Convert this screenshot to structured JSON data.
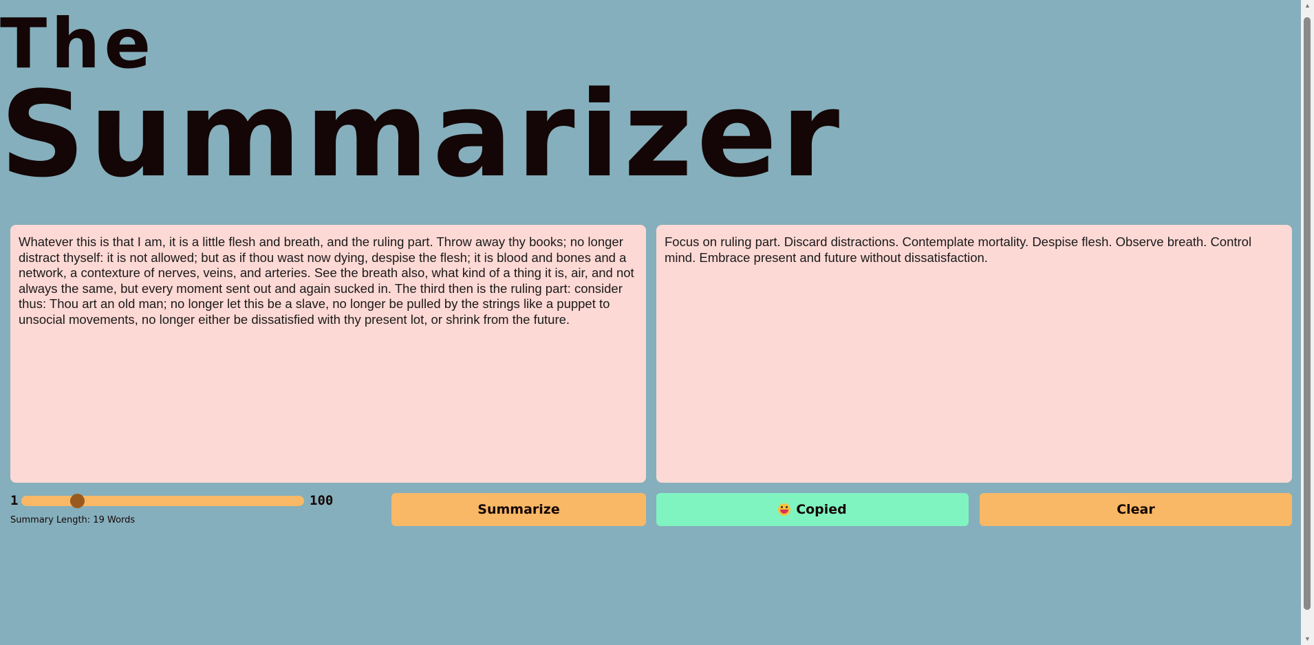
{
  "header": {
    "title_small": "The",
    "title_large": "Summarizer"
  },
  "input_panel": {
    "text": "Whatever this is that I am, it is a little flesh and breath, and the ruling part. Throw away thy books; no longer distract thyself: it is not allowed; but as if thou wast now dying, despise the flesh; it is blood and bones and a network, a contexture of nerves, veins, and arteries. See the breath also, what kind of a thing it is, air, and not always the same, but every moment sent out and again sucked in. The third then is the ruling part: consider thus: Thou art an old man; no longer let this be a slave, no longer be pulled by the strings like a puppet to unsocial movements, no longer either be dissatisfied with thy present lot, or shrink from the future."
  },
  "output_panel": {
    "text": "Focus on ruling part. Discard distractions. Contemplate mortality. Despise flesh. Observe breath. Control mind. Embrace present and future without dissatisfaction."
  },
  "slider": {
    "min_label": "1",
    "max_label": "100",
    "min": 1,
    "max": 100,
    "value": 19,
    "length_label": "Summary Length: 19 Words"
  },
  "buttons": {
    "summarize_label": "Summarize",
    "copied_label": "Copied",
    "copied_icon": "grinning-face-with-tongue-icon",
    "clear_label": "Clear"
  },
  "colors": {
    "background": "#85afbc",
    "panel": "#fdd9d5",
    "button_primary": "#f9b866",
    "button_copied": "#7ff4c0",
    "slider_thumb": "#9a5a1f",
    "title_text": "#140606"
  }
}
